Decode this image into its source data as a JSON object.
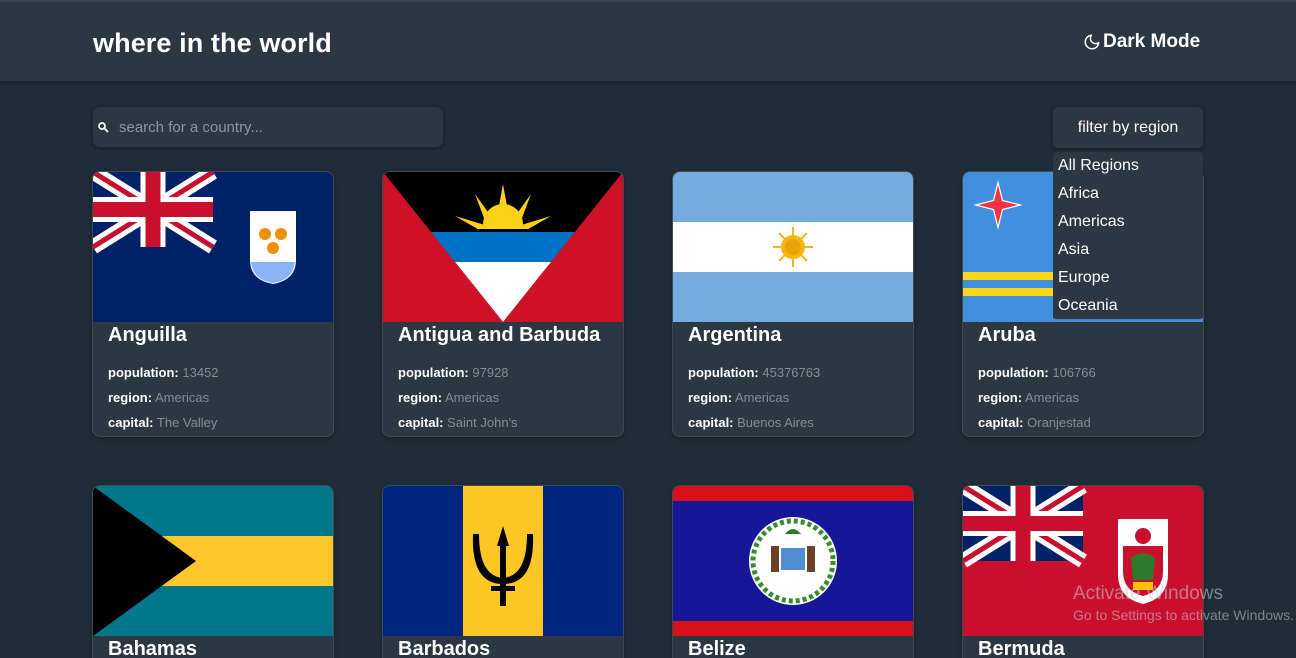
{
  "header": {
    "title": "where in the world",
    "mode_label": "Dark Mode"
  },
  "search": {
    "placeholder": "search for a country..."
  },
  "filter": {
    "label": "filter by region",
    "options": [
      "All Regions",
      "Africa",
      "Americas",
      "Asia",
      "Europe",
      "Oceania"
    ]
  },
  "labels": {
    "population": "population:",
    "region": "region:",
    "capital": "capital:"
  },
  "countries": [
    {
      "name": "Anguilla",
      "population": "13452",
      "region": "Americas",
      "capital": "The Valley"
    },
    {
      "name": "Antigua and Barbuda",
      "population": "97928",
      "region": "Americas",
      "capital": "Saint John's"
    },
    {
      "name": "Argentina",
      "population": "45376763",
      "region": "Americas",
      "capital": "Buenos Aires"
    },
    {
      "name": "Aruba",
      "population": "106766",
      "region": "Americas",
      "capital": "Oranjestad"
    },
    {
      "name": "Bahamas"
    },
    {
      "name": "Barbados"
    },
    {
      "name": "Belize"
    },
    {
      "name": "Bermuda"
    }
  ],
  "watermark": {
    "line1": "Activate Windows",
    "line2": "Go to Settings to activate Windows."
  },
  "colors": {
    "background": "#202c37",
    "elements": "#2b3743",
    "muted_text": "#858d96"
  }
}
